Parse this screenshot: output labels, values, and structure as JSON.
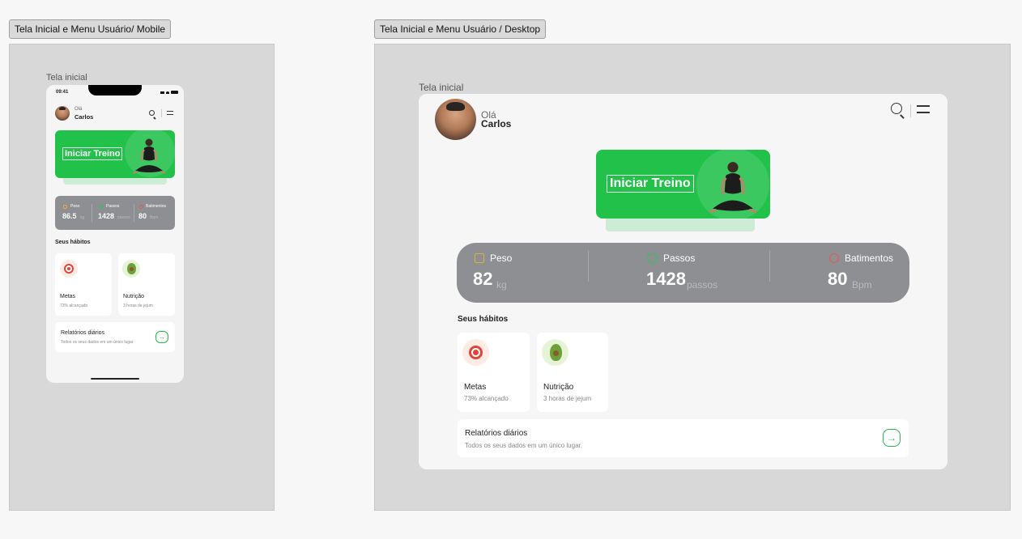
{
  "frames": {
    "mobile_label": "Tela Inicial e Menu Usuário/ Mobile",
    "desktop_label": "Tela Inicial e Menu Usuário / Desktop"
  },
  "mobile": {
    "screen_label": "Tela inicial",
    "status_time": "09:41",
    "greeting": "Olá",
    "user_name": "Carlos",
    "hero_title": "Iniciar Treino",
    "stats": [
      {
        "label": "Peso",
        "value": "86.5",
        "unit": "kg",
        "icon": "weight-icon"
      },
      {
        "label": "Passos",
        "value": "1428",
        "unit": "passos",
        "icon": "steps-icon"
      },
      {
        "label": "Batimentos",
        "value": "80",
        "unit": "Bpm",
        "icon": "heart-icon"
      }
    ],
    "habits_title": "Seus hábitos",
    "habits": [
      {
        "title": "Metas",
        "subtitle": "73% alcançado",
        "icon": "target-icon"
      },
      {
        "title": "Nutrição",
        "subtitle": "3 horas de jejum",
        "icon": "avocado-icon"
      }
    ],
    "report": {
      "title": "Relatórios diários",
      "subtitle": "Todos os seus dados em um único lugar.",
      "arrow": "→"
    }
  },
  "desktop": {
    "screen_label": "Tela inicial",
    "greeting": "Olá",
    "user_name": "Carlos",
    "hero_title": "Iniciar Treino",
    "stats": [
      {
        "label": "Peso",
        "value": "82",
        "unit": "kg",
        "icon": "weight-icon"
      },
      {
        "label": "Passos",
        "value": "1428",
        "unit": "passos",
        "icon": "steps-icon"
      },
      {
        "label": "Batimentos",
        "value": "80",
        "unit": "Bpm",
        "icon": "heart-icon"
      }
    ],
    "habits_title": "Seus hábitos",
    "habits": [
      {
        "title": "Metas",
        "subtitle": "73% alcançado",
        "icon": "target-icon"
      },
      {
        "title": "Nutrição",
        "subtitle": "3 horas de jejum",
        "icon": "avocado-icon"
      }
    ],
    "report": {
      "title": "Relatórios diários",
      "subtitle": "Todos os seus dados em um único lugar.",
      "arrow": "→"
    }
  },
  "colors": {
    "accent_green": "#21c14a",
    "stats_bg": "#8d8f92",
    "canvas": "#d8d8d8"
  }
}
